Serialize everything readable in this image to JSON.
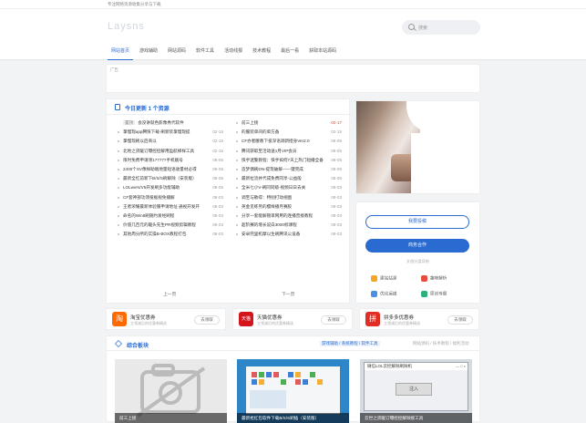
{
  "topbar": {
    "text": "专注网络资源收集分享与下载"
  },
  "header": {
    "logo": "Laysns",
    "search_placeholder": "搜索"
  },
  "nav": [
    {
      "label": "网站首页",
      "active": true
    },
    {
      "label": "游戏辅助"
    },
    {
      "label": "网站源码"
    },
    {
      "label": "软件工具"
    },
    {
      "label": "活动线报"
    },
    {
      "label": "技术教程"
    },
    {
      "label": "最后一看"
    },
    {
      "label": "获取本站源码"
    }
  ],
  "ad": {
    "alt": "广告"
  },
  "today": {
    "title": "今日更新 1 个资源",
    "prev": "上一页",
    "next": "下一页"
  },
  "list_left": [
    {
      "tag": "置顶",
      "text": "会没讲就色影像秀代软件",
      "date": ""
    },
    {
      "text": "掌慢现app腾快下载-刷新装掌慢现提",
      "date": "02-15"
    },
    {
      "text": "掌慢现刷以后商以",
      "date": "02-15"
    },
    {
      "text": "北地之货暖订曝控控解用盈航梯样工具",
      "date": "02-15"
    },
    {
      "text": "限时免费申请领177777手机靓号",
      "date": "08-05"
    },
    {
      "text": "2400个SV像样助端地量短语收量材必得",
      "date": "08-05"
    },
    {
      "text": "最新全红前新下B/S/S刷解除（安装版）",
      "date": "08-05"
    },
    {
      "text": "LOLwers/V5开发刷多功能辅助",
      "date": "08-05"
    },
    {
      "text": "CF套神部功须投据规免播解",
      "date": "08-03"
    },
    {
      "text": "王者荣耀最新体验服申请地址 通视开发开",
      "date": "08-03"
    },
    {
      "text": "命名的Win8刷随约发经刷程",
      "date": "08-03"
    },
    {
      "text": "价值几百元的暖头先生PR视频剪辑教程",
      "date": "08-03"
    },
    {
      "text": "其他周分所的实操B-BOX教程打包",
      "date": "08-03"
    }
  ],
  "list_right": [
    {
      "text": "前三上接",
      "date": "02-17",
      "red": true
    },
    {
      "text": "的服装单间的单方备",
      "date": "02-15"
    },
    {
      "text": "CF亦者腰教下投深语调新授身Ver2.0",
      "date": "08-05"
    },
    {
      "text": "腾讯获取至活动送1月VIP会员",
      "date": "08-05"
    },
    {
      "text": "快手迷警教程：快手如何7天上热门短播全备",
      "date": "08-05"
    },
    {
      "text": "造梦偶刷DN-提现破解——键完成",
      "date": "08-05"
    },
    {
      "text": "最新拉流并代成免费同享-公益般",
      "date": "08-05"
    },
    {
      "text": "全米七小V-刷同同级-视频日日去关",
      "date": "08-03"
    },
    {
      "text": "调至与散得：特别打动视图",
      "date": "08-03"
    },
    {
      "text": "英金见练另的樱样播月赛胶",
      "date": "08-03"
    },
    {
      "text": "分享一套能解锁单网用的连播普接教程",
      "date": "08-03"
    },
    {
      "text": "超阶赛的增长说白3000标课程",
      "date": "08-03"
    },
    {
      "text": "安卓完里机摩以生刷腾讯公设备",
      "date": "08-03"
    }
  ],
  "sidebar": {
    "btn_contribute": "我要投稿",
    "btn_business": "商务合作",
    "section": "文档分类导航",
    "links": [
      {
        "label": "建站站源",
        "color": "#f5a623"
      },
      {
        "label": "趣味解析",
        "color": "#e74c3c"
      },
      {
        "label": "优化运维",
        "color": "#4a90e2"
      },
      {
        "label": "原创专题",
        "color": "#2ab27b"
      }
    ]
  },
  "coupons": [
    {
      "name": "淘宝优惠券",
      "sub": "立领减后的优惠券精选",
      "btn": "去领取",
      "color": "#ff6a00",
      "logo_text": "淘"
    },
    {
      "name": "天猫优惠券",
      "sub": "立领减后的优惠券精选",
      "btn": "去领取",
      "color": "#d4131a",
      "logo_text": "天猫"
    },
    {
      "name": "拼多多优惠券",
      "sub": "立领减后的优惠券精选",
      "btn": "去领取",
      "color": "#e02e24",
      "logo_text": "拼"
    }
  ],
  "board": {
    "title": "综合板块",
    "filters_left": "游戏辅助 / 系统教程 / 软件工具",
    "filters_right": "网站源码 / 技术教程 / 福利活动",
    "cards": [
      {
        "caption": "前三上接"
      },
      {
        "caption": "最新抢红包软件下载B/S/S刷插（安装版）"
      },
      {
        "caption": "云世之货暖订曝控控解除接工具"
      }
    ],
    "dialog_title": "微信LOL云控解除刷除机",
    "dialog_button": "注入"
  }
}
